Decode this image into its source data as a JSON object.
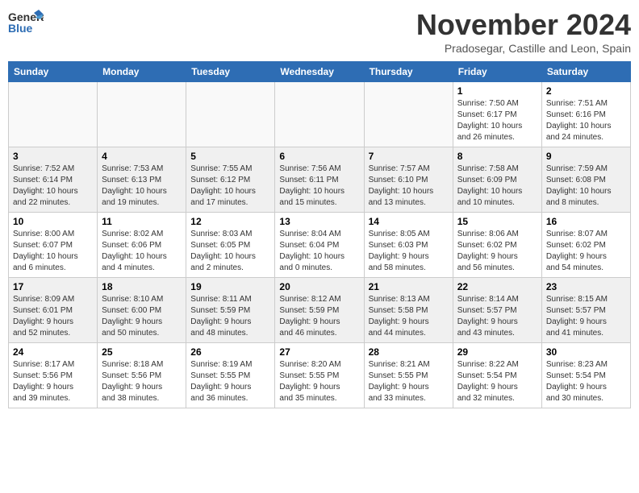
{
  "header": {
    "logo_line1": "General",
    "logo_line2": "Blue",
    "month": "November 2024",
    "location": "Pradosegar, Castille and Leon, Spain"
  },
  "days_of_week": [
    "Sunday",
    "Monday",
    "Tuesday",
    "Wednesday",
    "Thursday",
    "Friday",
    "Saturday"
  ],
  "weeks": [
    [
      {
        "day": "",
        "info": ""
      },
      {
        "day": "",
        "info": ""
      },
      {
        "day": "",
        "info": ""
      },
      {
        "day": "",
        "info": ""
      },
      {
        "day": "",
        "info": ""
      },
      {
        "day": "1",
        "info": "Sunrise: 7:50 AM\nSunset: 6:17 PM\nDaylight: 10 hours\nand 26 minutes."
      },
      {
        "day": "2",
        "info": "Sunrise: 7:51 AM\nSunset: 6:16 PM\nDaylight: 10 hours\nand 24 minutes."
      }
    ],
    [
      {
        "day": "3",
        "info": "Sunrise: 7:52 AM\nSunset: 6:14 PM\nDaylight: 10 hours\nand 22 minutes."
      },
      {
        "day": "4",
        "info": "Sunrise: 7:53 AM\nSunset: 6:13 PM\nDaylight: 10 hours\nand 19 minutes."
      },
      {
        "day": "5",
        "info": "Sunrise: 7:55 AM\nSunset: 6:12 PM\nDaylight: 10 hours\nand 17 minutes."
      },
      {
        "day": "6",
        "info": "Sunrise: 7:56 AM\nSunset: 6:11 PM\nDaylight: 10 hours\nand 15 minutes."
      },
      {
        "day": "7",
        "info": "Sunrise: 7:57 AM\nSunset: 6:10 PM\nDaylight: 10 hours\nand 13 minutes."
      },
      {
        "day": "8",
        "info": "Sunrise: 7:58 AM\nSunset: 6:09 PM\nDaylight: 10 hours\nand 10 minutes."
      },
      {
        "day": "9",
        "info": "Sunrise: 7:59 AM\nSunset: 6:08 PM\nDaylight: 10 hours\nand 8 minutes."
      }
    ],
    [
      {
        "day": "10",
        "info": "Sunrise: 8:00 AM\nSunset: 6:07 PM\nDaylight: 10 hours\nand 6 minutes."
      },
      {
        "day": "11",
        "info": "Sunrise: 8:02 AM\nSunset: 6:06 PM\nDaylight: 10 hours\nand 4 minutes."
      },
      {
        "day": "12",
        "info": "Sunrise: 8:03 AM\nSunset: 6:05 PM\nDaylight: 10 hours\nand 2 minutes."
      },
      {
        "day": "13",
        "info": "Sunrise: 8:04 AM\nSunset: 6:04 PM\nDaylight: 10 hours\nand 0 minutes."
      },
      {
        "day": "14",
        "info": "Sunrise: 8:05 AM\nSunset: 6:03 PM\nDaylight: 9 hours\nand 58 minutes."
      },
      {
        "day": "15",
        "info": "Sunrise: 8:06 AM\nSunset: 6:02 PM\nDaylight: 9 hours\nand 56 minutes."
      },
      {
        "day": "16",
        "info": "Sunrise: 8:07 AM\nSunset: 6:02 PM\nDaylight: 9 hours\nand 54 minutes."
      }
    ],
    [
      {
        "day": "17",
        "info": "Sunrise: 8:09 AM\nSunset: 6:01 PM\nDaylight: 9 hours\nand 52 minutes."
      },
      {
        "day": "18",
        "info": "Sunrise: 8:10 AM\nSunset: 6:00 PM\nDaylight: 9 hours\nand 50 minutes."
      },
      {
        "day": "19",
        "info": "Sunrise: 8:11 AM\nSunset: 5:59 PM\nDaylight: 9 hours\nand 48 minutes."
      },
      {
        "day": "20",
        "info": "Sunrise: 8:12 AM\nSunset: 5:59 PM\nDaylight: 9 hours\nand 46 minutes."
      },
      {
        "day": "21",
        "info": "Sunrise: 8:13 AM\nSunset: 5:58 PM\nDaylight: 9 hours\nand 44 minutes."
      },
      {
        "day": "22",
        "info": "Sunrise: 8:14 AM\nSunset: 5:57 PM\nDaylight: 9 hours\nand 43 minutes."
      },
      {
        "day": "23",
        "info": "Sunrise: 8:15 AM\nSunset: 5:57 PM\nDaylight: 9 hours\nand 41 minutes."
      }
    ],
    [
      {
        "day": "24",
        "info": "Sunrise: 8:17 AM\nSunset: 5:56 PM\nDaylight: 9 hours\nand 39 minutes."
      },
      {
        "day": "25",
        "info": "Sunrise: 8:18 AM\nSunset: 5:56 PM\nDaylight: 9 hours\nand 38 minutes."
      },
      {
        "day": "26",
        "info": "Sunrise: 8:19 AM\nSunset: 5:55 PM\nDaylight: 9 hours\nand 36 minutes."
      },
      {
        "day": "27",
        "info": "Sunrise: 8:20 AM\nSunset: 5:55 PM\nDaylight: 9 hours\nand 35 minutes."
      },
      {
        "day": "28",
        "info": "Sunrise: 8:21 AM\nSunset: 5:55 PM\nDaylight: 9 hours\nand 33 minutes."
      },
      {
        "day": "29",
        "info": "Sunrise: 8:22 AM\nSunset: 5:54 PM\nDaylight: 9 hours\nand 32 minutes."
      },
      {
        "day": "30",
        "info": "Sunrise: 8:23 AM\nSunset: 5:54 PM\nDaylight: 9 hours\nand 30 minutes."
      }
    ]
  ]
}
